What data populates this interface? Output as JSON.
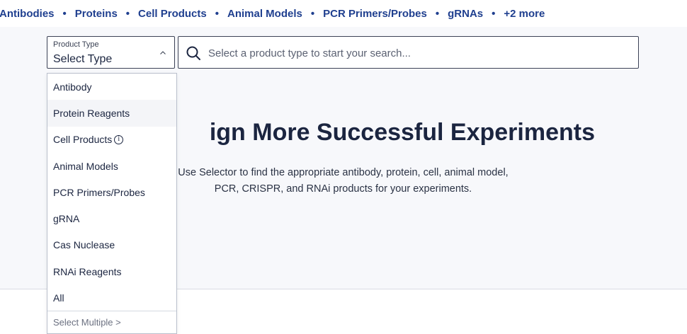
{
  "nav": {
    "links": [
      "Antibodies",
      "Proteins",
      "Cell Products",
      "Animal Models",
      "PCR Primers/Probes",
      "gRNAs",
      "+2 more"
    ],
    "separator": "•"
  },
  "product_type": {
    "label": "Product Type",
    "value": "Select Type"
  },
  "search": {
    "placeholder": "Select a product type to start your search..."
  },
  "hero": {
    "headline": "ign More Successful Experiments",
    "subtext": "Use Selector to find the appropriate antibody, protein, cell, animal model, PCR, CRISPR, and RNAi products for your experiments."
  },
  "dropdown": {
    "items": [
      "Antibody",
      "Protein Reagents",
      "Cell Products",
      "Animal Models",
      "PCR Primers/Probes",
      "gRNA",
      "Cas Nuclease",
      "RNAi Reagents",
      "All"
    ],
    "footer": "Select Multiple >"
  },
  "colors": {
    "nav_link": "#1f3f8f",
    "text_dark": "#1b2540",
    "hero_bg": "#f7f8fb"
  }
}
